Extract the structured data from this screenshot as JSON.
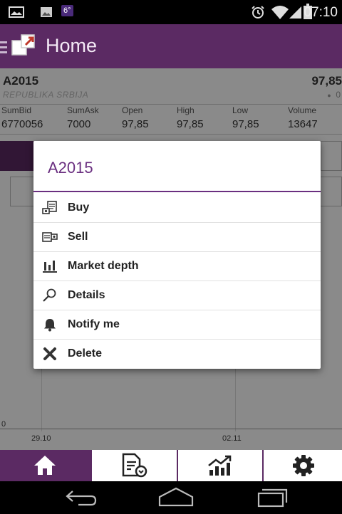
{
  "status_bar": {
    "time": "07:10",
    "temperature": "6°",
    "icons": [
      "screenshot-icon",
      "gallery-icon",
      "alarm-icon",
      "wifi-icon",
      "signal-icon",
      "battery-icon"
    ]
  },
  "action_bar": {
    "title": "Home",
    "icons": [
      "drawer-icon",
      "app-logo-icon"
    ]
  },
  "stock": {
    "code": "A2015",
    "name": "REPUBLIKA SRBIJA",
    "price": "97,85",
    "change": "0",
    "headers": [
      "SumBid",
      "SumAsk",
      "Open",
      "High",
      "Low",
      "Volume"
    ],
    "values": [
      "6770056",
      "7000",
      "97,85",
      "97,85",
      "97,85",
      "13647"
    ]
  },
  "chart": {
    "y_label": "0",
    "x_labels": [
      "29.10",
      "02.11"
    ]
  },
  "dialog": {
    "title": "A2015",
    "items": [
      {
        "label": "Buy",
        "icon": "buy-icon"
      },
      {
        "label": "Sell",
        "icon": "sell-icon"
      },
      {
        "label": "Market depth",
        "icon": "market-depth-icon"
      },
      {
        "label": "Details",
        "icon": "search-icon"
      },
      {
        "label": "Notify me",
        "icon": "bell-icon"
      },
      {
        "label": "Delete",
        "icon": "close-icon"
      }
    ]
  },
  "tabs": [
    {
      "icon": "home-icon",
      "selected": true
    },
    {
      "icon": "document-icon",
      "selected": false
    },
    {
      "icon": "chart-icon",
      "selected": false
    },
    {
      "icon": "gear-icon",
      "selected": false
    }
  ],
  "nav_bar": [
    "back-icon",
    "home-nav-icon",
    "recents-icon"
  ],
  "colors": {
    "primary": "#5b2a63",
    "accent": "#6a2f80"
  }
}
